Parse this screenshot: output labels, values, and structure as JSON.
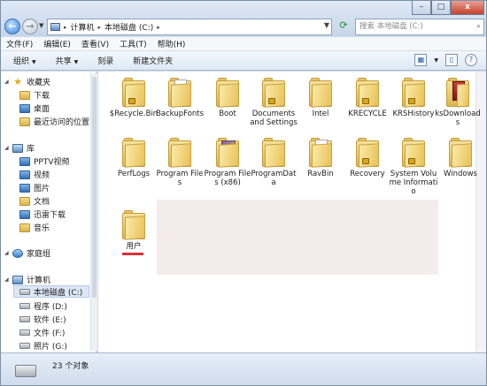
{
  "titlebar": {
    "minimize": "–",
    "maximize": "□",
    "close": "x"
  },
  "nav": {
    "back_icon": "back-arrow-icon",
    "back_glyph": "←",
    "forward_glyph": "→",
    "address": [
      "计算机",
      "本地磁盘 (C:)"
    ],
    "search_placeholder": "搜索 本地磁盘 (C:)"
  },
  "menubar": [
    "文件(F)",
    "编辑(E)",
    "查看(V)",
    "工具(T)",
    "帮助(H)"
  ],
  "cmdbar": {
    "organize": "组织",
    "share": "共享",
    "burn": "刻录",
    "new_folder": "新建文件夹"
  },
  "navpane": {
    "favorites": "收藏夹",
    "downloads": "下载",
    "desktop": "桌面",
    "recent": "最近访问的位置",
    "libraries": "库",
    "pptv": "PPTV视频",
    "videos": "视频",
    "pictures": "图片",
    "documents": "文档",
    "xunlei": "迅雷下载",
    "music": "音乐",
    "homegroup": "家庭组",
    "computer": "计算机",
    "drive_c": "本地磁盘 (C:)",
    "drive_d": "程序 (D:)",
    "drive_e": "软件 (E:)",
    "drive_f": "文件 (F:)",
    "drive_g": "照片 (G:)"
  },
  "folders": [
    "$Recycle.Bin",
    "BackupFonts",
    "Boot",
    "Documents and Settings",
    "Intel",
    "KRECYCLE",
    "KRSHistory",
    "ksDownloads",
    "PerfLogs",
    "Program Files",
    "Program Files (x86)",
    "ProgramData",
    "RavBin",
    "Recovery",
    "System Volume Informatio",
    "Windows",
    "用户"
  ],
  "status": {
    "count": "23 个对象"
  }
}
